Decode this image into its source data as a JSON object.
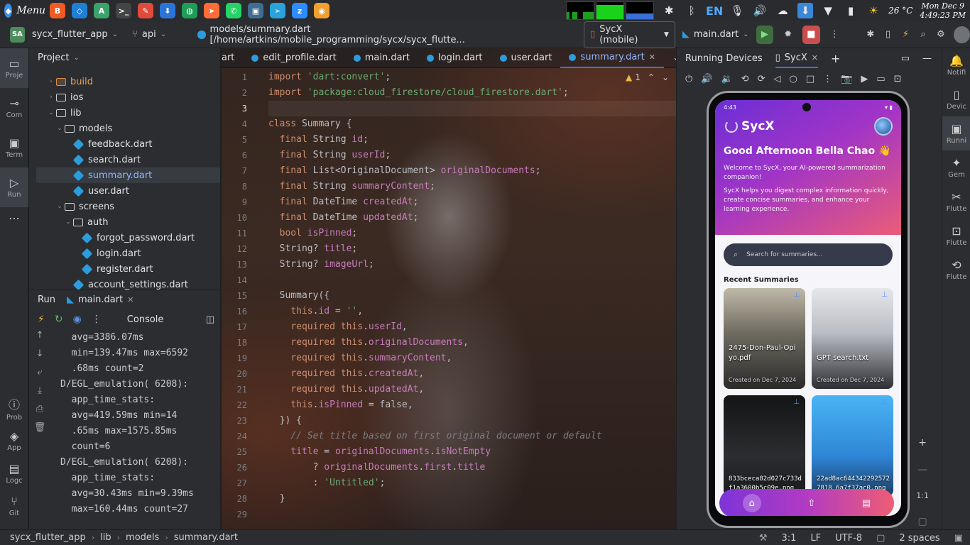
{
  "os": {
    "menu_label": "Menu",
    "lang": "EN",
    "temperature": "26 °C",
    "date": "Mon Dec 9",
    "time": "4:49:23 PM",
    "launcher_apps": [
      "brave-icon",
      "vscode-icon",
      "android-studio-icon",
      "terminal-icon",
      "text-editor-icon",
      "downloader-icon",
      "mongodb-icon",
      "postman-icon",
      "whatsapp-icon",
      "virtualbox-icon",
      "telegram-icon",
      "zoom-icon",
      "app-launcher-icon"
    ]
  },
  "toolbar": {
    "project_badge": "SA",
    "project_name": "sycx_flutter_app",
    "branch": "api",
    "file_path": "models/summary.dart [/home/artkins/mobile_programming/sycx/sycx_flutte...",
    "device": "SycX (mobile)",
    "run_config": "main.dart"
  },
  "left_strip": [
    {
      "label": "Proje",
      "icon": "folder-icon"
    },
    {
      "label": "Com",
      "icon": "commit-icon"
    },
    {
      "label": "Term",
      "icon": "terminal-icon"
    },
    {
      "label": "Run",
      "icon": "run-icon"
    },
    {
      "label": "Prob",
      "icon": "problems-icon"
    },
    {
      "label": "App",
      "icon": "app-quality-icon"
    },
    {
      "label": "Logc",
      "icon": "logcat-icon"
    },
    {
      "label": "Git",
      "icon": "git-icon"
    }
  ],
  "project": {
    "title": "Project",
    "tree": [
      {
        "name": "build",
        "indent": 1,
        "kind": "folder-build",
        "arrow": "›"
      },
      {
        "name": "ios",
        "indent": 1,
        "kind": "folder",
        "arrow": "›"
      },
      {
        "name": "lib",
        "indent": 1,
        "kind": "folder",
        "arrow": "⌄"
      },
      {
        "name": "models",
        "indent": 2,
        "kind": "folder",
        "arrow": "⌄"
      },
      {
        "name": "feedback.dart",
        "indent": 3,
        "kind": "dart",
        "arrow": ""
      },
      {
        "name": "search.dart",
        "indent": 3,
        "kind": "dart",
        "arrow": ""
      },
      {
        "name": "summary.dart",
        "indent": 3,
        "kind": "dart",
        "arrow": "",
        "selected": true
      },
      {
        "name": "user.dart",
        "indent": 3,
        "kind": "dart",
        "arrow": ""
      },
      {
        "name": "screens",
        "indent": 2,
        "kind": "folder",
        "arrow": "⌄"
      },
      {
        "name": "auth",
        "indent": 3,
        "kind": "folder",
        "arrow": "⌄"
      },
      {
        "name": "forgot_password.dart",
        "indent": 4,
        "kind": "dart",
        "arrow": ""
      },
      {
        "name": "login.dart",
        "indent": 4,
        "kind": "dart",
        "arrow": ""
      },
      {
        "name": "register.dart",
        "indent": 4,
        "kind": "dart",
        "arrow": ""
      },
      {
        "name": "account_settings.dart",
        "indent": 3,
        "kind": "dart",
        "arrow": ""
      }
    ]
  },
  "run": {
    "tab_run": "Run",
    "tab_main": "main.dart",
    "console_label": "Console",
    "console_lines": [
      "  avg=3386.07ms",
      "  min=139.47ms max=6592",
      "  .68ms count=2",
      "D/EGL_emulation( 6208):",
      "  app_time_stats:",
      "  avg=419.59ms min=14",
      "  .65ms max=1575.85ms",
      "  count=6",
      "D/EGL_emulation( 6208):",
      "  app_time_stats:",
      "  avg=30.43ms min=9.39ms",
      "  max=160.44ms count=27"
    ]
  },
  "editor": {
    "tabs": [
      {
        "name": "art",
        "active": false
      },
      {
        "name": "edit_profile.dart",
        "active": false
      },
      {
        "name": "main.dart",
        "active": false
      },
      {
        "name": "login.dart",
        "active": false
      },
      {
        "name": "user.dart",
        "active": false
      },
      {
        "name": "summary.dart",
        "active": true
      }
    ],
    "warnings": "1",
    "line_numbers": [
      "1",
      "2",
      "3",
      "4",
      "5",
      "6",
      "7",
      "8",
      "9",
      "10",
      "11",
      "12",
      "13",
      "14",
      "15",
      "16",
      "17",
      "18",
      "19",
      "20",
      "21",
      "22",
      "23",
      "24",
      "25",
      "26",
      "27",
      "28",
      "29"
    ],
    "code_lines": [
      "import 'dart:convert';",
      "import 'package:cloud_firestore/cloud_firestore.dart';",
      "",
      "class Summary {",
      "  final String id;",
      "  final String userId;",
      "  final List<OriginalDocument> originalDocuments;",
      "  final String summaryContent;",
      "  final DateTime createdAt;",
      "  final DateTime updatedAt;",
      "  bool isPinned;",
      "  String? title;",
      "  String? imageUrl;",
      "",
      "  Summary({",
      "    this.id = '',",
      "    required this.userId,",
      "    required this.originalDocuments,",
      "    required this.summaryContent,",
      "    required this.createdAt,",
      "    required this.updatedAt,",
      "    this.isPinned = false,",
      "  }) {",
      "    // Set title based on first original document or default",
      "    title = originalDocuments.isNotEmpty",
      "        ? originalDocuments.first.title",
      "        : 'Untitled';",
      "  }",
      ""
    ]
  },
  "devices": {
    "title": "Running Devices",
    "tab": "SycX",
    "zoom_label": "1:1"
  },
  "phone": {
    "status_time": "4:43",
    "brand": "SycX",
    "greeting": "Good Afternoon Bella Chao 👋",
    "intro1": "Welcome to SycX, your AI-powered summarization companion!",
    "intro2": "SycX helps you digest complex information quickly, create concise summaries, and enhance your learning experience.",
    "search_placeholder": "Search for summaries...",
    "recent_title": "Recent Summaries",
    "cards": [
      {
        "name": "2475-Don-Paul-Opiyo.pdf",
        "date": "Created on Dec 7, 2024"
      },
      {
        "name": "GPT search.txt",
        "date": "Created on Dec 7, 2024"
      },
      {
        "name": "833bceca82d027c733df1a3600b5c09e.png",
        "date": ""
      },
      {
        "name": "22ad8ac6443422925727818 6a7f37ac0.png",
        "date": ""
      }
    ]
  },
  "right_strip": [
    {
      "label": "Notifi",
      "icon": "bell-icon"
    },
    {
      "label": "Devic",
      "icon": "device-manager-icon"
    },
    {
      "label": "Runni",
      "icon": "running-devices-icon"
    },
    {
      "label": "Gem",
      "icon": "gemini-icon"
    },
    {
      "label": "Flutte",
      "icon": "flutter-inspector-icon"
    },
    {
      "label": "Flutte",
      "icon": "flutter-outline-icon"
    },
    {
      "label": "Flutte",
      "icon": "flutter-performance-icon"
    }
  ],
  "status": {
    "crumbs": [
      "sycx_flutter_app",
      "lib",
      "models",
      "summary.dart"
    ],
    "position": "3:1",
    "line_sep": "LF",
    "encoding": "UTF-8",
    "indent": "2 spaces"
  }
}
